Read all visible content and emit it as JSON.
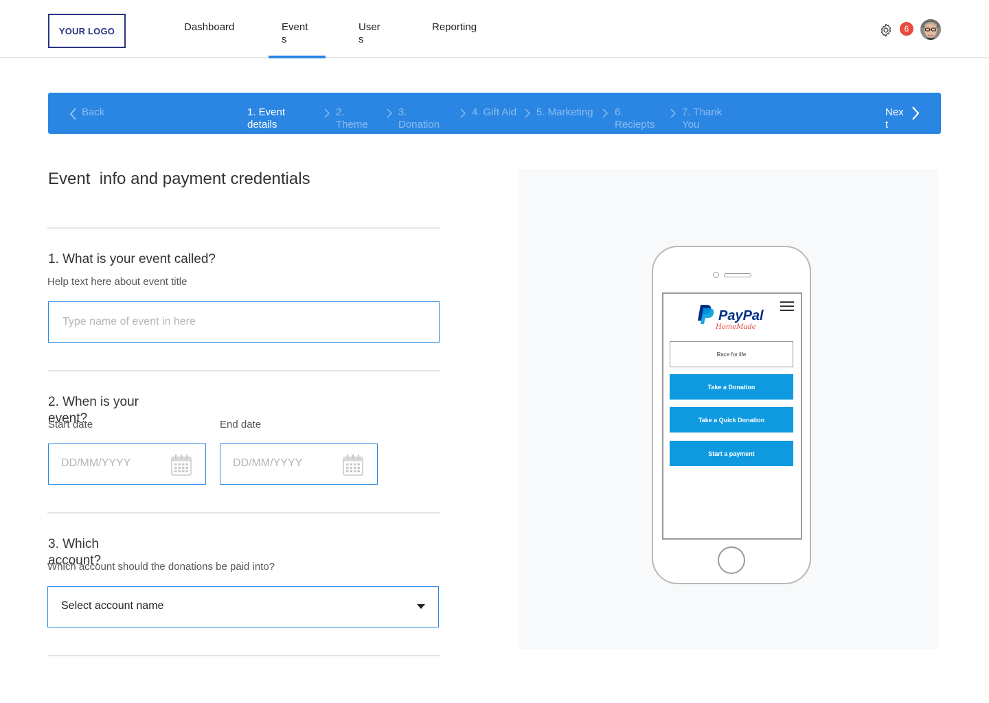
{
  "header": {
    "logo": "YOUR LOGO",
    "nav": [
      "Dashboard",
      "Events",
      "Users",
      "Reporting"
    ],
    "active_nav": "Events",
    "notification_count": "6"
  },
  "stepper": {
    "back": "Back",
    "next": "Next",
    "steps": [
      "1. Event details",
      "2. Theme",
      "3. Donation",
      "4. Gift Aid",
      "5. Marketing",
      "6. Reciepts",
      "7. Thank You"
    ],
    "active_step": "1. Event details"
  },
  "form": {
    "title": "Event  info and payment credentials",
    "q1": {
      "title": "1. What is your event called?",
      "help": "Help text here about event title",
      "placeholder": "Type name of event in here"
    },
    "q2": {
      "title": "2. When is your event?",
      "start_label": "Start date",
      "end_label": "End date",
      "date_placeholder": "DD/MM/YYYY"
    },
    "q3": {
      "title": "3. Which account?",
      "help": "Which account should the donations be paid into?",
      "select_value": "Select account name"
    }
  },
  "preview": {
    "brand": "PayPal",
    "brand_sub": "HomeMade",
    "input_value": "Race for life",
    "buttons": [
      "Take a Donation",
      "Take a Quick Donation",
      "Start a payment"
    ]
  },
  "colors": {
    "accent": "#2b86e3",
    "logo": "#2b3483",
    "badge": "#e74c3c",
    "paypal_button": "#0f9ae0"
  }
}
